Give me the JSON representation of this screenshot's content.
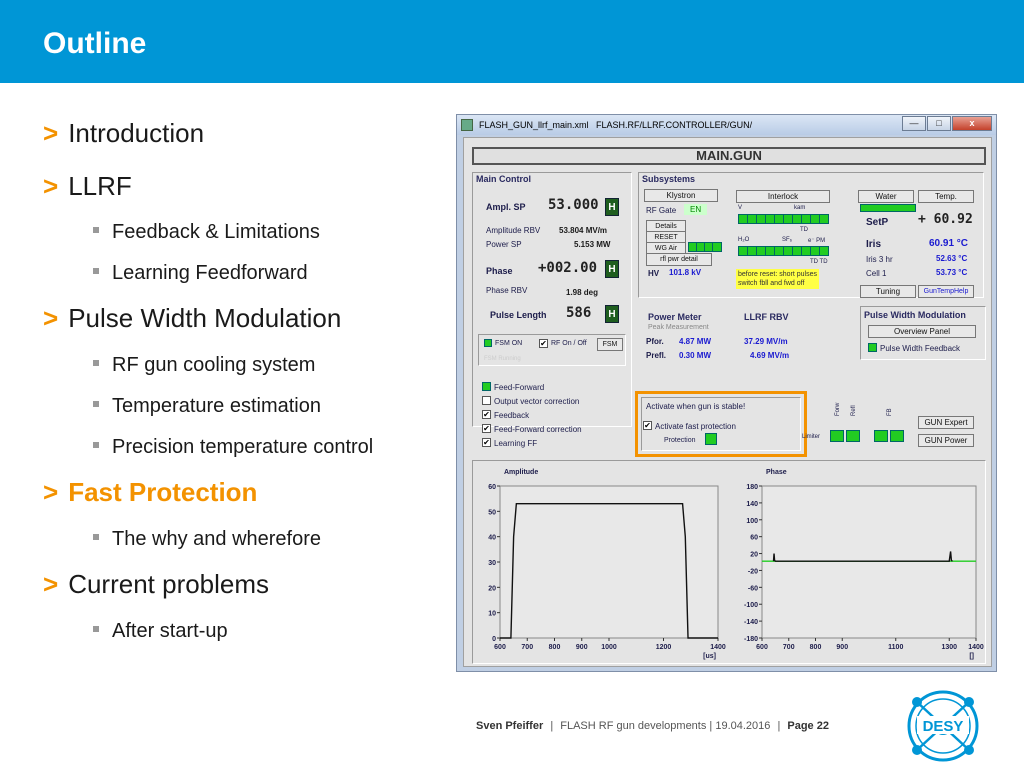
{
  "slide": {
    "title": "Outline",
    "bullets": [
      {
        "text": "Introduction"
      },
      {
        "text": "LLRF"
      },
      {
        "text": "Pulse Width Modulation"
      },
      {
        "text": "Fast Protection"
      },
      {
        "text": "Current problems"
      }
    ],
    "sub": [
      {
        "text": "Feedback & Limitations"
      },
      {
        "text": "Learning Feedforward"
      },
      {
        "text": "RF gun cooling system"
      },
      {
        "text": "Temperature estimation"
      },
      {
        "text": "Precision temperature control"
      },
      {
        "text": "The why and wherefore"
      },
      {
        "text": "After start-up"
      }
    ],
    "bullet_marker": ">",
    "accent_color": "#f39200",
    "header_color": "#0096d6",
    "footer": {
      "author": "Sven Pfeiffer",
      "sep": "|",
      "desc": "FLASH RF gun developments | 19.04.2016",
      "page": "Page 22"
    },
    "logo_text": "DESY"
  },
  "window": {
    "file": "FLASH_GUN_llrf_main.xml",
    "path": "FLASH.RF/LLRF.CONTROLLER/GUN/",
    "min": "—",
    "max": "□",
    "close": "x",
    "main_title": "MAIN.GUN"
  },
  "main_control": {
    "title": "Main Control",
    "ampl_sp_label": "Ampl. SP",
    "ampl_sp_value": "53.000",
    "h": "H",
    "ampl_rbv_label": "Amplitude RBV",
    "ampl_rbv_value": "53.804 MV/m",
    "power_sp_label": "Power SP",
    "power_sp_value": "5.153 MW",
    "phase_label": "Phase",
    "phase_value": "+002.00",
    "phase_rbv_label": "Phase RBV",
    "phase_rbv_value": "1.98 deg",
    "pulse_length_label": "Pulse Length",
    "pulse_length_value": "586",
    "fsm_on": "FSM ON",
    "rf_onoff": "RF On / Off",
    "fsm_btn": "FSM",
    "fsm_running": "FSM Running"
  },
  "options": [
    {
      "label": "Feed-Forward",
      "state": "led"
    },
    {
      "label": "Output vector correction",
      "state": "off"
    },
    {
      "label": "Feedback",
      "state": "on"
    },
    {
      "label": "Feed-Forward correction",
      "state": "on"
    },
    {
      "label": "Learning FF",
      "state": "on"
    }
  ],
  "subsystems": {
    "title": "Subsystems",
    "klystron": "Klystron",
    "rf_gate": "RF Gate",
    "en": "EN",
    "details": "Details",
    "reset": "RESET",
    "wg_air": "WG Air",
    "refl": "rfl pwr detail",
    "hv_label": "HV",
    "hv_value": "101.8 kV",
    "interlock": "Interlock",
    "il_v": "V",
    "il_kam": "kam",
    "il_td": "TD",
    "il_h2o": "H₂O",
    "il_sf6": "SF₆",
    "il_pm": "e⁻ PM",
    "il_tdtd": "TD TD",
    "note": [
      "before reset: short pulses",
      "switch fbll and fwd off"
    ],
    "water": "Water",
    "temp": "Temp.",
    "setp_label": "SetP",
    "setp_value": "+ 60.92",
    "iris_label": "Iris",
    "iris_value": "60.91 °C",
    "iris3_label": "Iris 3 hr",
    "iris3_value": "52.63 °C",
    "cell1_label": "Cell 1",
    "cell1_value": "53.73 °C",
    "tuning": "Tuning",
    "guntemphelp": "GunTempHelp"
  },
  "power_meter": {
    "title": "Power Meter",
    "subtitle": "Peak Measurement",
    "pfor_label": "Pfor.",
    "pfor_value": "4.87 MW",
    "prefl_label": "Prefl.",
    "prefl_value": "0.30 MW",
    "llrf_title": "LLRF RBV",
    "rbv1": "37.29 MV/m",
    "rbv2": "4.69 MV/m"
  },
  "pwm": {
    "title": "Pulse Width Modulation",
    "overview": "Overview Panel",
    "feedback": "Pulse Width Feedback"
  },
  "fast_protection": {
    "title": "Activate when gun is stable!",
    "activate": "Activate fast protection",
    "protection": "Protection",
    "limiter": "Limiter",
    "forw": "Forw",
    "refl": "Refl",
    "fb": "FB",
    "gun_expert": "GUN Expert",
    "gun_power": "GUN Power"
  },
  "chart_data": [
    {
      "type": "line",
      "title": "Amplitude",
      "xlabel": "[us]",
      "x_ticks": [
        600,
        700,
        800,
        900,
        1000,
        1200,
        1400
      ],
      "y_ticks": [
        0,
        10,
        20,
        30,
        40,
        50,
        60
      ],
      "xlim": [
        600,
        1400
      ],
      "ylim": [
        0,
        60
      ],
      "series": [
        {
          "color": "#111111",
          "x": [
            600,
            640,
            650,
            660,
            1270,
            1280,
            1290,
            1400
          ],
          "y": [
            0,
            0,
            40,
            53,
            53,
            40,
            0,
            0
          ]
        }
      ]
    },
    {
      "type": "line",
      "title": "Phase",
      "xlabel": "[]",
      "x_ticks": [
        600,
        700,
        800,
        900,
        1100,
        1300,
        1400
      ],
      "y_ticks": [
        180,
        140,
        100,
        60,
        20,
        -20,
        -60,
        -100,
        -140,
        -180
      ],
      "xlim": [
        600,
        1400
      ],
      "ylim": [
        -180,
        180
      ],
      "series": [
        {
          "color": "#22cc22",
          "x": [
            600,
            1400
          ],
          "y": [
            2,
            2
          ]
        },
        {
          "color": "#111111",
          "x": [
            643,
            645,
            647,
            650,
            1300,
            1305,
            1308,
            1312
          ],
          "y": [
            2,
            20,
            4,
            2,
            2,
            25,
            4,
            2
          ]
        }
      ]
    }
  ]
}
